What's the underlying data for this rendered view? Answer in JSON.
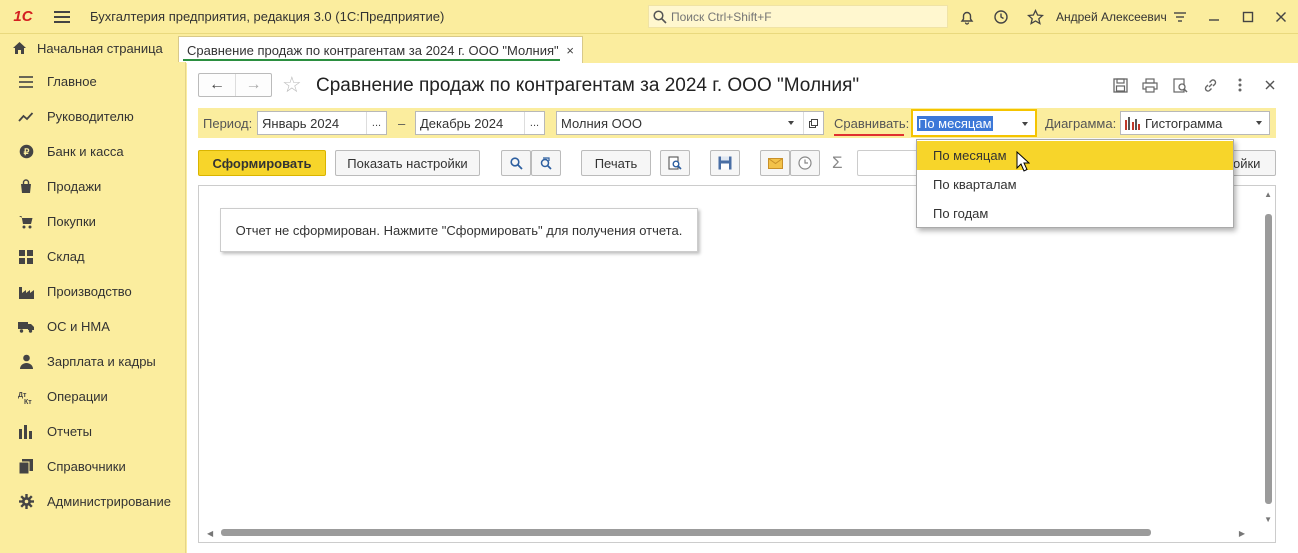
{
  "titlebar": {
    "logo": "1С",
    "app_title": "Бухгалтерия предприятия, редакция 3.0  (1С:Предприятие)",
    "search_placeholder": "Поиск Ctrl+Shift+F",
    "user": "Андрей Алексеевич"
  },
  "tabs": {
    "home": "Начальная страница",
    "active": "Сравнение продаж по контрагентам за 2024 г. ООО \"Молния\"",
    "close": "×"
  },
  "sidebar": {
    "items": [
      {
        "label": "Главное",
        "icon": "menu-lines-icon"
      },
      {
        "label": "Руководителю",
        "icon": "trend-icon"
      },
      {
        "label": "Банк и касса",
        "icon": "coin-icon"
      },
      {
        "label": "Продажи",
        "icon": "bag-icon"
      },
      {
        "label": "Покупки",
        "icon": "cart-icon"
      },
      {
        "label": "Склад",
        "icon": "grid-icon"
      },
      {
        "label": "Производство",
        "icon": "factory-icon"
      },
      {
        "label": "ОС и НМА",
        "icon": "truck-icon"
      },
      {
        "label": "Зарплата и кадры",
        "icon": "person-icon"
      },
      {
        "label": "Операции",
        "icon": "dt-kt-icon"
      },
      {
        "label": "Отчеты",
        "icon": "bar-chart-icon"
      },
      {
        "label": "Справочники",
        "icon": "book-icon"
      },
      {
        "label": "Администрирование",
        "icon": "gear-icon"
      }
    ]
  },
  "header": {
    "title": "Сравнение продаж по контрагентам за 2024 г. ООО \"Молния\""
  },
  "params": {
    "period_label": "Период:",
    "period_from": "Январь 2024",
    "dash": "–",
    "period_to": "Декабрь 2024",
    "dots": "...",
    "org": "Молния ООО",
    "compare_label": "Сравнивать:",
    "compare_value": "По месяцам",
    "chart_label": "Диаграмма:",
    "chart_value": "Гистограмма"
  },
  "commands": {
    "generate": "Сформировать",
    "show_settings": "Показать настройки",
    "print": "Печать",
    "settings_tail": "ойки",
    "sigma": "Σ"
  },
  "report": {
    "message": "Отчет не сформирован. Нажмите \"Сформировать\" для получения отчета."
  },
  "dropdown": {
    "options": [
      "По месяцам",
      "По кварталам",
      "По годам"
    ],
    "selected": "По месяцам"
  },
  "colors": {
    "accent": "#f7d52a",
    "background": "#fbed9e",
    "logo_red": "#d42020",
    "tab_underline": "#2b8f40"
  }
}
